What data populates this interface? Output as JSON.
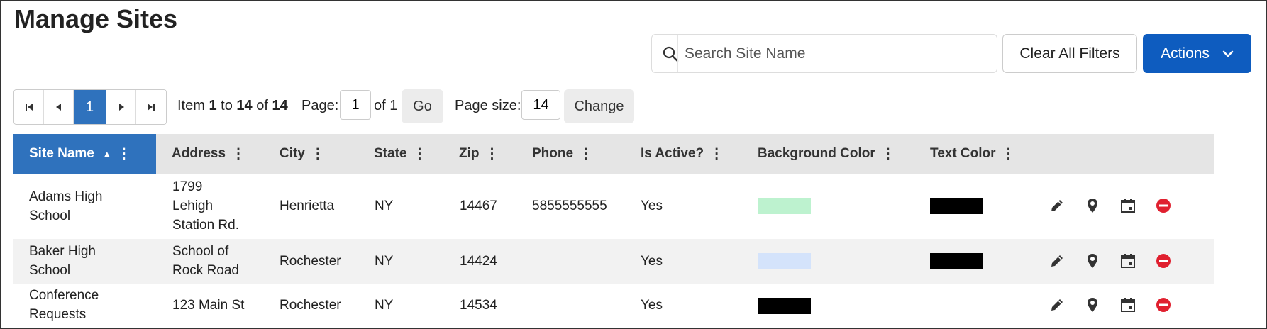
{
  "page": {
    "title": "Manage Sites"
  },
  "search": {
    "placeholder": "Search Site Name",
    "value": ""
  },
  "toolbar": {
    "clear_label": "Clear All Filters",
    "actions_label": "Actions"
  },
  "pager": {
    "current_page": "1",
    "info_prefix": "Item",
    "info_from": "1",
    "info_to_word": "to",
    "info_to": "14",
    "info_of_word": "of",
    "info_total": "14",
    "page_label": "Page:",
    "page_value": "1",
    "page_of": "of 1",
    "go_label": "Go",
    "size_label": "Page size:",
    "size_value": "14",
    "change_label": "Change"
  },
  "columns": [
    {
      "label": "Site Name",
      "sorted": "ascending"
    },
    {
      "label": "Address"
    },
    {
      "label": "City"
    },
    {
      "label": "State"
    },
    {
      "label": "Zip"
    },
    {
      "label": "Phone"
    },
    {
      "label": "Is Active?"
    },
    {
      "label": "Background Color"
    },
    {
      "label": "Text Color"
    }
  ],
  "rows": [
    {
      "site_name_1": "Adams High",
      "site_name_2": "School",
      "address_1": "1799",
      "address_2": "Lehigh",
      "address_3": "Station Rd.",
      "city": "Henrietta",
      "state": "NY",
      "zip": "14467",
      "phone": "5855555555",
      "active": "Yes",
      "bg_color": "#bdf2cf",
      "text_color": "#000000"
    },
    {
      "site_name_1": "Baker High",
      "site_name_2": "School",
      "address_1": "School of",
      "address_2": "Rock Road",
      "city": "Rochester",
      "state": "NY",
      "zip": "14424",
      "phone": "",
      "active": "Yes",
      "bg_color": "#d4e3fb",
      "text_color": "#000000"
    },
    {
      "site_name_1": "Conference",
      "site_name_2": "Requests",
      "address_1": "123 Main St",
      "city": "Rochester",
      "state": "NY",
      "zip": "14534",
      "phone": "",
      "active": "Yes",
      "bg_color": "#000000",
      "text_color": "#000000"
    }
  ],
  "icons": {
    "edit": "pencil-icon",
    "location": "map-pin-icon",
    "calendar": "calendar-icon",
    "delete": "remove-icon"
  },
  "colors": {
    "primary": "#0e5cbf",
    "header_sorted": "#2f72bd",
    "header_bg": "#e5e5e5",
    "delete_red": "#e0202f"
  }
}
